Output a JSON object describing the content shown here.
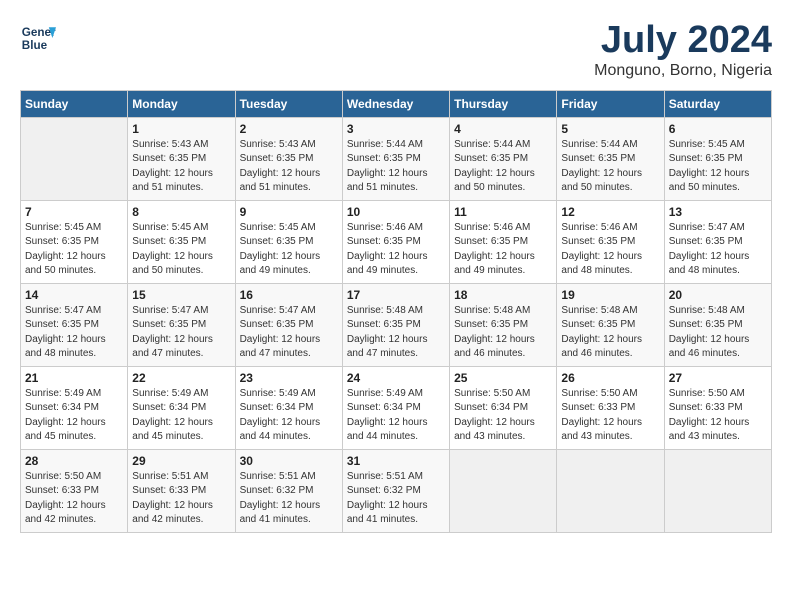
{
  "header": {
    "logo_line1": "General",
    "logo_line2": "Blue",
    "month_year": "July 2024",
    "location": "Monguno, Borno, Nigeria"
  },
  "weekdays": [
    "Sunday",
    "Monday",
    "Tuesday",
    "Wednesday",
    "Thursday",
    "Friday",
    "Saturday"
  ],
  "weeks": [
    [
      {
        "day": "",
        "sunrise": "",
        "sunset": "",
        "daylight": ""
      },
      {
        "day": "1",
        "sunrise": "5:43 AM",
        "sunset": "6:35 PM",
        "daylight": "12 hours and 51 minutes."
      },
      {
        "day": "2",
        "sunrise": "5:43 AM",
        "sunset": "6:35 PM",
        "daylight": "12 hours and 51 minutes."
      },
      {
        "day": "3",
        "sunrise": "5:44 AM",
        "sunset": "6:35 PM",
        "daylight": "12 hours and 51 minutes."
      },
      {
        "day": "4",
        "sunrise": "5:44 AM",
        "sunset": "6:35 PM",
        "daylight": "12 hours and 50 minutes."
      },
      {
        "day": "5",
        "sunrise": "5:44 AM",
        "sunset": "6:35 PM",
        "daylight": "12 hours and 50 minutes."
      },
      {
        "day": "6",
        "sunrise": "5:45 AM",
        "sunset": "6:35 PM",
        "daylight": "12 hours and 50 minutes."
      }
    ],
    [
      {
        "day": "7",
        "sunrise": "5:45 AM",
        "sunset": "6:35 PM",
        "daylight": "12 hours and 50 minutes."
      },
      {
        "day": "8",
        "sunrise": "5:45 AM",
        "sunset": "6:35 PM",
        "daylight": "12 hours and 50 minutes."
      },
      {
        "day": "9",
        "sunrise": "5:45 AM",
        "sunset": "6:35 PM",
        "daylight": "12 hours and 49 minutes."
      },
      {
        "day": "10",
        "sunrise": "5:46 AM",
        "sunset": "6:35 PM",
        "daylight": "12 hours and 49 minutes."
      },
      {
        "day": "11",
        "sunrise": "5:46 AM",
        "sunset": "6:35 PM",
        "daylight": "12 hours and 49 minutes."
      },
      {
        "day": "12",
        "sunrise": "5:46 AM",
        "sunset": "6:35 PM",
        "daylight": "12 hours and 48 minutes."
      },
      {
        "day": "13",
        "sunrise": "5:47 AM",
        "sunset": "6:35 PM",
        "daylight": "12 hours and 48 minutes."
      }
    ],
    [
      {
        "day": "14",
        "sunrise": "5:47 AM",
        "sunset": "6:35 PM",
        "daylight": "12 hours and 48 minutes."
      },
      {
        "day": "15",
        "sunrise": "5:47 AM",
        "sunset": "6:35 PM",
        "daylight": "12 hours and 47 minutes."
      },
      {
        "day": "16",
        "sunrise": "5:47 AM",
        "sunset": "6:35 PM",
        "daylight": "12 hours and 47 minutes."
      },
      {
        "day": "17",
        "sunrise": "5:48 AM",
        "sunset": "6:35 PM",
        "daylight": "12 hours and 47 minutes."
      },
      {
        "day": "18",
        "sunrise": "5:48 AM",
        "sunset": "6:35 PM",
        "daylight": "12 hours and 46 minutes."
      },
      {
        "day": "19",
        "sunrise": "5:48 AM",
        "sunset": "6:35 PM",
        "daylight": "12 hours and 46 minutes."
      },
      {
        "day": "20",
        "sunrise": "5:48 AM",
        "sunset": "6:35 PM",
        "daylight": "12 hours and 46 minutes."
      }
    ],
    [
      {
        "day": "21",
        "sunrise": "5:49 AM",
        "sunset": "6:34 PM",
        "daylight": "12 hours and 45 minutes."
      },
      {
        "day": "22",
        "sunrise": "5:49 AM",
        "sunset": "6:34 PM",
        "daylight": "12 hours and 45 minutes."
      },
      {
        "day": "23",
        "sunrise": "5:49 AM",
        "sunset": "6:34 PM",
        "daylight": "12 hours and 44 minutes."
      },
      {
        "day": "24",
        "sunrise": "5:49 AM",
        "sunset": "6:34 PM",
        "daylight": "12 hours and 44 minutes."
      },
      {
        "day": "25",
        "sunrise": "5:50 AM",
        "sunset": "6:34 PM",
        "daylight": "12 hours and 43 minutes."
      },
      {
        "day": "26",
        "sunrise": "5:50 AM",
        "sunset": "6:33 PM",
        "daylight": "12 hours and 43 minutes."
      },
      {
        "day": "27",
        "sunrise": "5:50 AM",
        "sunset": "6:33 PM",
        "daylight": "12 hours and 43 minutes."
      }
    ],
    [
      {
        "day": "28",
        "sunrise": "5:50 AM",
        "sunset": "6:33 PM",
        "daylight": "12 hours and 42 minutes."
      },
      {
        "day": "29",
        "sunrise": "5:51 AM",
        "sunset": "6:33 PM",
        "daylight": "12 hours and 42 minutes."
      },
      {
        "day": "30",
        "sunrise": "5:51 AM",
        "sunset": "6:32 PM",
        "daylight": "12 hours and 41 minutes."
      },
      {
        "day": "31",
        "sunrise": "5:51 AM",
        "sunset": "6:32 PM",
        "daylight": "12 hours and 41 minutes."
      },
      {
        "day": "",
        "sunrise": "",
        "sunset": "",
        "daylight": ""
      },
      {
        "day": "",
        "sunrise": "",
        "sunset": "",
        "daylight": ""
      },
      {
        "day": "",
        "sunrise": "",
        "sunset": "",
        "daylight": ""
      }
    ]
  ]
}
